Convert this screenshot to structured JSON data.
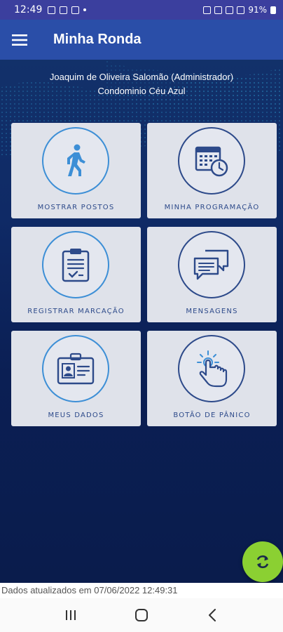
{
  "status_bar": {
    "time": "12:49",
    "battery": "91%"
  },
  "app_bar": {
    "title": "Minha Ronda"
  },
  "user": {
    "name_line": "Joaquim de Oliveira Salomão (Administrador)",
    "condo_line": "Condominio Céu Azul"
  },
  "menu": [
    {
      "label": "MOSTRAR POSTOS",
      "icon": "walking-person-icon"
    },
    {
      "label": "MINHA PROGRAMAÇÃO",
      "icon": "calendar-clock-icon"
    },
    {
      "label": "REGISTRAR MARCAÇÃO",
      "icon": "clipboard-checklist-icon"
    },
    {
      "label": "MENSAGENS",
      "icon": "chat-bubbles-icon"
    },
    {
      "label": "MEUS DADOS",
      "icon": "id-badge-icon"
    },
    {
      "label": "BOTÃO DE PÂNICO",
      "icon": "touch-press-icon"
    }
  ],
  "footer": {
    "updated_text": "Dados atualizados em 07/06/2022 12:49:31"
  },
  "colors": {
    "app_bar": "#2a4ea8",
    "card": "#dfe2ea",
    "accent": "#3d8fd6",
    "fab": "#8bd032"
  }
}
